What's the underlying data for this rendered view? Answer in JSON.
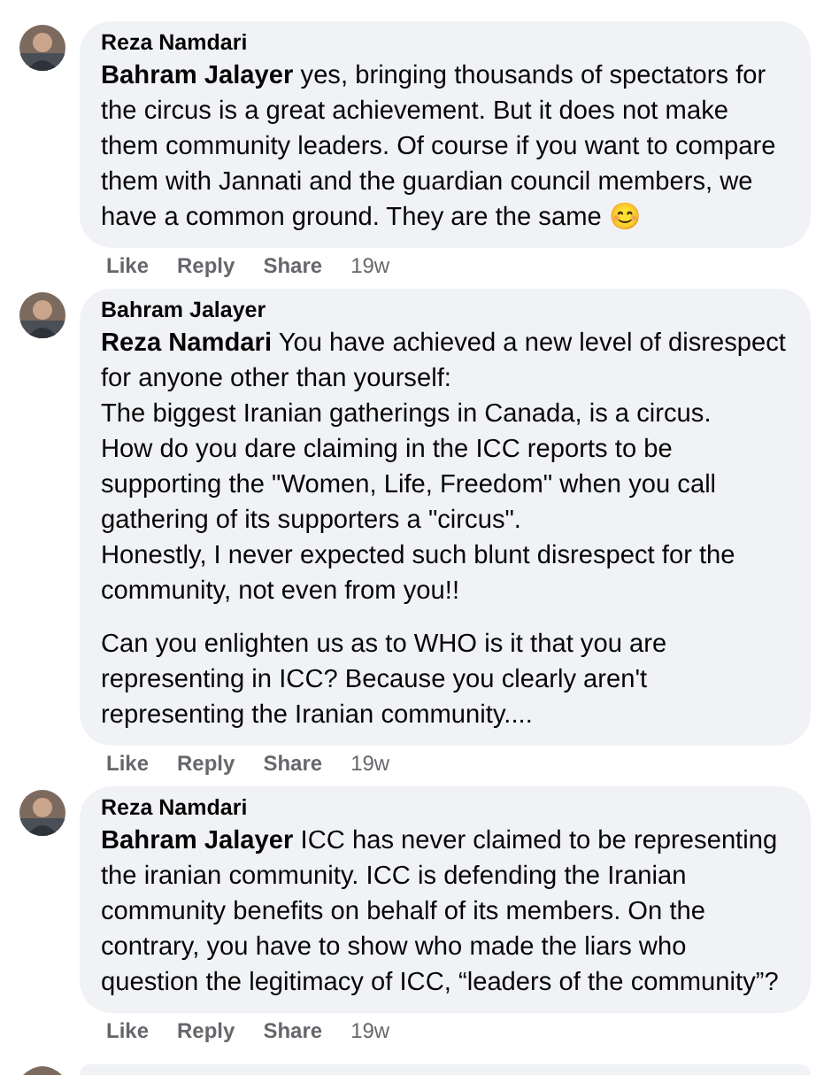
{
  "comments": [
    {
      "author": "Reza Namdari",
      "paragraphs": [
        "**Bahram Jalayer** yes, bringing thousands of spectators for the circus is a great achievement. But it does not make them community leaders. Of course if you want to compare them with Jannati and the guardian council members, we have a common ground. They are the same 😊"
      ],
      "actions": [
        "Like",
        "Reply",
        "Share"
      ],
      "time": "19w"
    },
    {
      "author": "Bahram Jalayer",
      "paragraphs": [
        "**Reza Namdari** You have achieved a new level of disrespect for anyone other than yourself:\nThe biggest Iranian gatherings in Canada, is a circus.\nHow do you dare claiming in the ICC reports to be supporting the \"Women, Life, Freedom\" when you call gathering of its supporters a \"circus\".\nHonestly, I never expected such blunt disrespect for the community, not even from you!!",
        "Can you enlighten us as to WHO is it that you are representing in ICC? Because you clearly aren't representing the Iranian community...."
      ],
      "actions": [
        "Like",
        "Reply",
        "Share"
      ],
      "time": "19w"
    },
    {
      "author": "Reza Namdari",
      "paragraphs": [
        "**Bahram Jalayer** ICC has never claimed to be representing the iranian community. ICC is defending the Iranian community benefits on behalf of its members. On the contrary, you have to show who made the liars who question the legitimacy of ICC, “leaders of the community”?"
      ],
      "actions": [
        "Like",
        "Reply",
        "Share"
      ],
      "time": "19w"
    }
  ]
}
